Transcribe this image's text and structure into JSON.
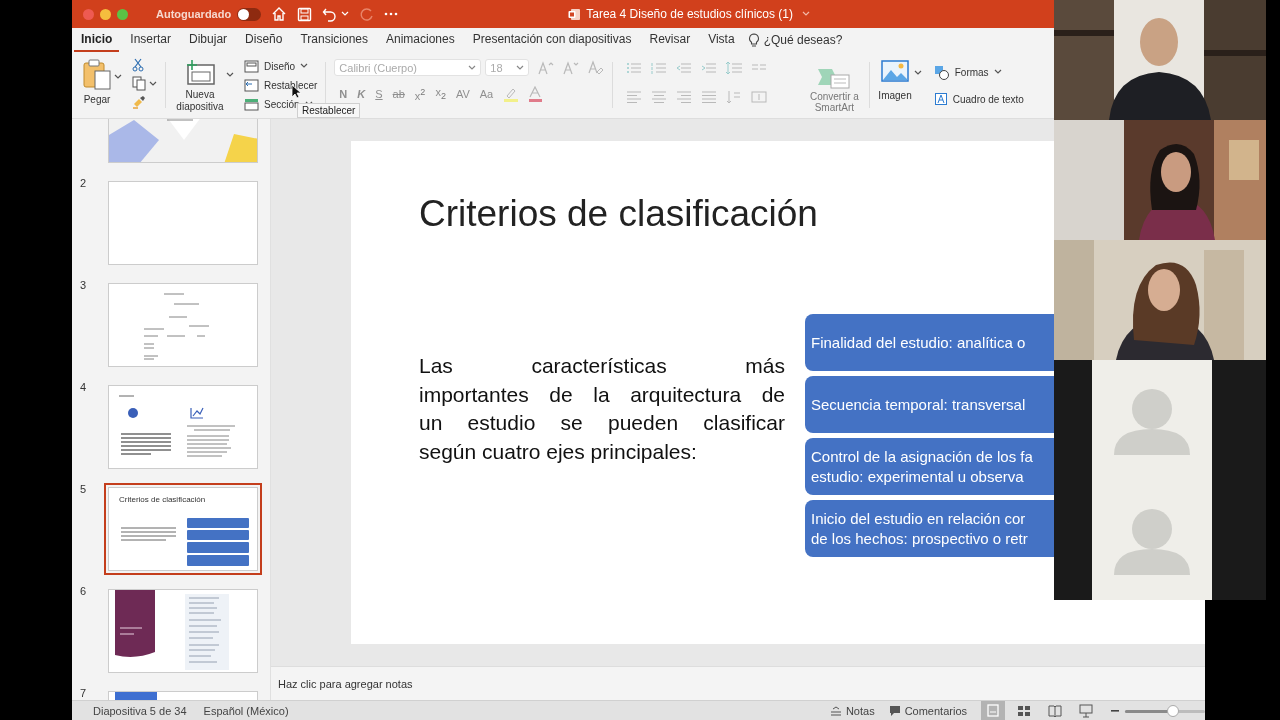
{
  "window": {
    "title": "Tarea 4 Diseño de estudios clínicos (1)",
    "autosave": {
      "label": "Autoguardado",
      "on": false
    }
  },
  "tabs": [
    {
      "label": "Inicio",
      "selected": true
    },
    {
      "label": "Insertar",
      "selected": false
    },
    {
      "label": "Dibujar",
      "selected": false
    },
    {
      "label": "Diseño",
      "selected": false
    },
    {
      "label": "Transiciones",
      "selected": false
    },
    {
      "label": "Animaciones",
      "selected": false
    },
    {
      "label": "Presentación con diapositivas",
      "selected": false
    },
    {
      "label": "Revisar",
      "selected": false
    },
    {
      "label": "Vista",
      "selected": false
    }
  ],
  "search": {
    "placeholder": "¿Qué deseas?"
  },
  "ribbon": {
    "paste": "Pegar",
    "new_slide": "Nueva diapositiva",
    "slide_commands": [
      {
        "label": "Diseño",
        "kind": "layout"
      },
      {
        "label": "Restablecer",
        "kind": "reset"
      },
      {
        "label": "Sección",
        "kind": "section"
      }
    ],
    "font": {
      "name": "Calibri (Cuerpo)",
      "size": "18",
      "disabled": true
    },
    "text_format": [
      "N",
      "K",
      "S",
      "ab",
      "x$^{2}$",
      "x$_{2}$",
      "AV",
      "Aa"
    ],
    "smartart": "Convertir a SmartArt",
    "picture": "Imagen",
    "shapes": "Formas",
    "text_box": "Cuadro de texto"
  },
  "tooltip": "Restablecer",
  "thumbnails": [
    {
      "kind": "title",
      "selected": false
    },
    {
      "number": "2",
      "kind": "blank",
      "selected": false
    },
    {
      "number": "3",
      "kind": "diagram",
      "selected": false
    },
    {
      "number": "4",
      "kind": "columns",
      "selected": false
    },
    {
      "number": "5",
      "kind": "boxes",
      "title": "Criterios de clasificación",
      "selected": true
    },
    {
      "number": "6",
      "kind": "sidebar",
      "selected": false
    },
    {
      "number": "7",
      "kind": "partial",
      "selected": false
    }
  ],
  "slide": {
    "title": "Criterios de clasificación",
    "body_lines": [
      "Las características más",
      "importantes de la arquitectura de",
      "un estudio se pueden clasificar",
      "según cuatro ejes principales:"
    ],
    "boxes": [
      {
        "lines": [
          "Finalidad del estudio: analítica o"
        ]
      },
      {
        "lines": [
          "Secuencia temporal: transversal"
        ]
      },
      {
        "lines": [
          "Control de la asignación de los fa",
          "estudio: experimental u observa"
        ]
      },
      {
        "lines": [
          "Inicio del estudio en relación cor",
          "de los hechos: prospectivo o retr"
        ]
      }
    ]
  },
  "notes": {
    "placeholder": "Haz clic para agregar notas"
  },
  "status_bar": {
    "slide": "Diapositiva 5 de 34",
    "language": "Español (México)",
    "notes": "Notas",
    "comments": "Comentarios",
    "views": [
      {
        "kind": "normal",
        "selected": true
      },
      {
        "kind": "sorter",
        "selected": false
      },
      {
        "kind": "reading",
        "selected": false
      },
      {
        "kind": "show",
        "selected": false
      }
    ],
    "zoom": {
      "level": 0.6
    }
  },
  "video_tiles": [
    {
      "kind": "camera"
    },
    {
      "kind": "camera"
    },
    {
      "kind": "camera"
    },
    {
      "kind": "avatar"
    },
    {
      "kind": "avatar"
    }
  ]
}
